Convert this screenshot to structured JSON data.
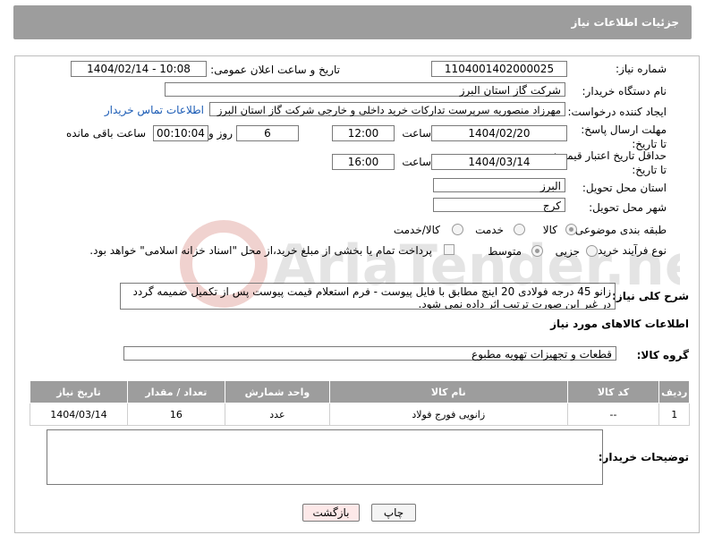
{
  "header": {
    "title": "جزئیات اطلاعات نیاز"
  },
  "form": {
    "need_number_label": "شماره نیاز:",
    "need_number": "1104001402000025",
    "announce_label": "تاریخ و ساعت اعلان عمومی:",
    "announce_value": "1404/02/14 - 10:08",
    "buyer_org_label": "نام دستگاه خریدار:",
    "buyer_org": "شرکت گاز استان البرز",
    "creator_label": "ایجاد کننده درخواست:",
    "creator": "مهرزاد منصوریه سرپرست تدارکات خرید داخلی و خارجی شرکت گاز استان البرز",
    "contact_link": "اطلاعات تماس خریدار",
    "deadline_label": "مهلت ارسال پاسخ: تا تاریخ:",
    "deadline_date": "1404/02/20",
    "time_label": "ساعت",
    "deadline_time": "12:00",
    "days_value": "6",
    "days_label": "روز و",
    "remaining_time": "00:10:04",
    "remaining_label": "ساعت باقی مانده",
    "validity_label": "حداقل تاریخ اعتبار قیمت: تا تاریخ:",
    "validity_date": "1404/03/14",
    "validity_time": "16:00",
    "province_label": "استان محل تحویل:",
    "province": "البرز",
    "city_label": "شهر محل تحویل:",
    "city": "کرج",
    "category_label": "طبقه بندی موضوعی:",
    "category_options": [
      "کالا",
      "خدمت",
      "کالا/خدمت"
    ],
    "process_label": "نوع فرآیند خرید :",
    "process_options": [
      "جزیی",
      "متوسط"
    ],
    "payment_note": "پرداخت تمام یا بخشی از مبلغ خرید،از محل \"اسناد خزانه اسلامی\" خواهد بود.",
    "description_label": "شرح کلی نیاز:",
    "description": "زانو 45 درجه فولادی 20 اینچ مطابق با فایل پیوست - فرم استعلام قیمت پیوست پس از تکمیل ضمیمه گردد در غیر این صورت ترتیب اثر داده نمی شود.",
    "goods_info_title": "اطلاعات کالاهای مورد نیاز",
    "goods_group_label": "گروه کالا:",
    "goods_group": "قطعات و تجهیزات تهویه مطبوع",
    "buyer_notes_label": "توضیحات خریدار:",
    "buyer_notes": ""
  },
  "table": {
    "headers": [
      "ردیف",
      "کد کالا",
      "نام کالا",
      "واحد شمارش",
      "تعداد / مقدار",
      "تاریخ نیاز"
    ],
    "rows": [
      [
        "1",
        "--",
        "زانویی فورج فولاد",
        "عدد",
        "16",
        "1404/03/14"
      ]
    ]
  },
  "buttons": {
    "print": "چاپ",
    "back": "بازگشت"
  },
  "watermark": "AriaTender.net",
  "colors": {
    "header_bg": "#9d9d9d",
    "link": "#1a5bb5",
    "back_button_bg": "#fde8e8"
  }
}
